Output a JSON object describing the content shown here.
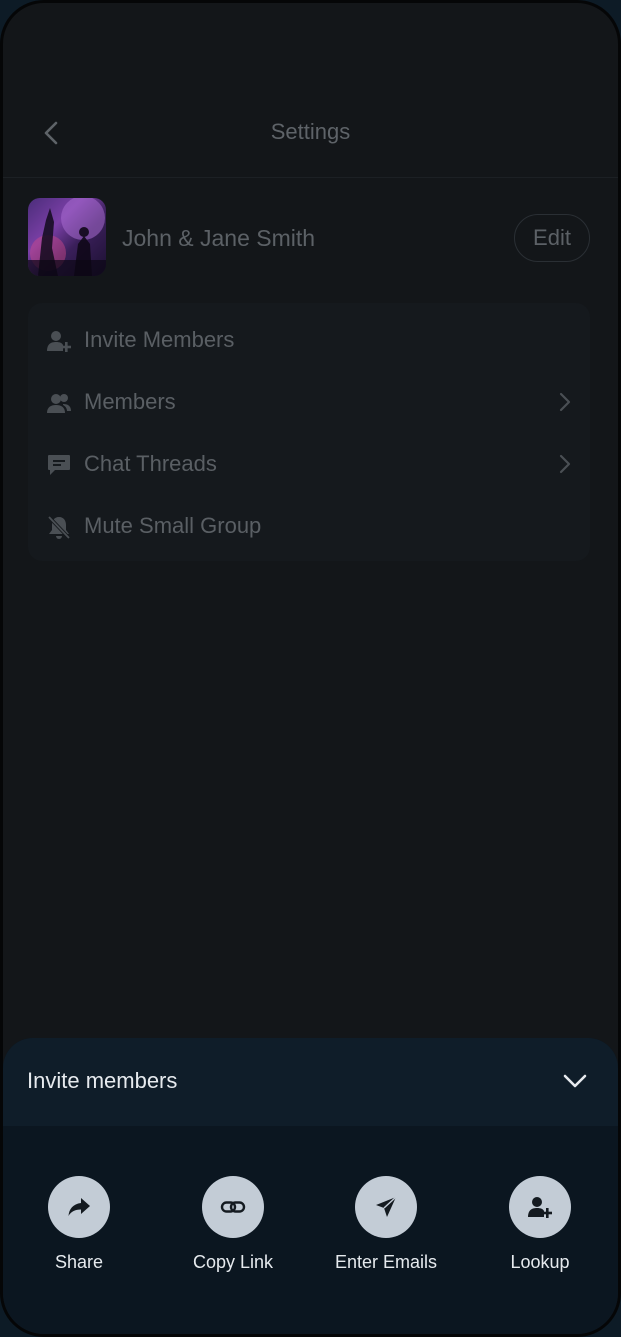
{
  "header": {
    "title": "Settings"
  },
  "group": {
    "name": "John & Jane Smith",
    "edit_label": "Edit"
  },
  "menu": {
    "items": [
      {
        "label": "Invite Members",
        "icon": "person-add-icon"
      },
      {
        "label": "Members",
        "icon": "people-icon"
      },
      {
        "label": "Chat Threads",
        "icon": "chat-icon"
      },
      {
        "label": "Mute Small Group",
        "icon": "bell-off-icon"
      }
    ]
  },
  "sheet": {
    "title": "Invite members",
    "actions": [
      {
        "label": "Share",
        "icon": "share-arrow-icon"
      },
      {
        "label": "Copy Link",
        "icon": "link-icon"
      },
      {
        "label": "Enter Emails",
        "icon": "send-icon"
      },
      {
        "label": "Lookup",
        "icon": "person-add-icon"
      }
    ]
  },
  "colors": {
    "background": "#131619",
    "dimmed_text": "#5a5f64",
    "sheet_background": "#0b1620",
    "action_circle": "#c3ccd6",
    "sheet_text": "#e6eaee"
  }
}
